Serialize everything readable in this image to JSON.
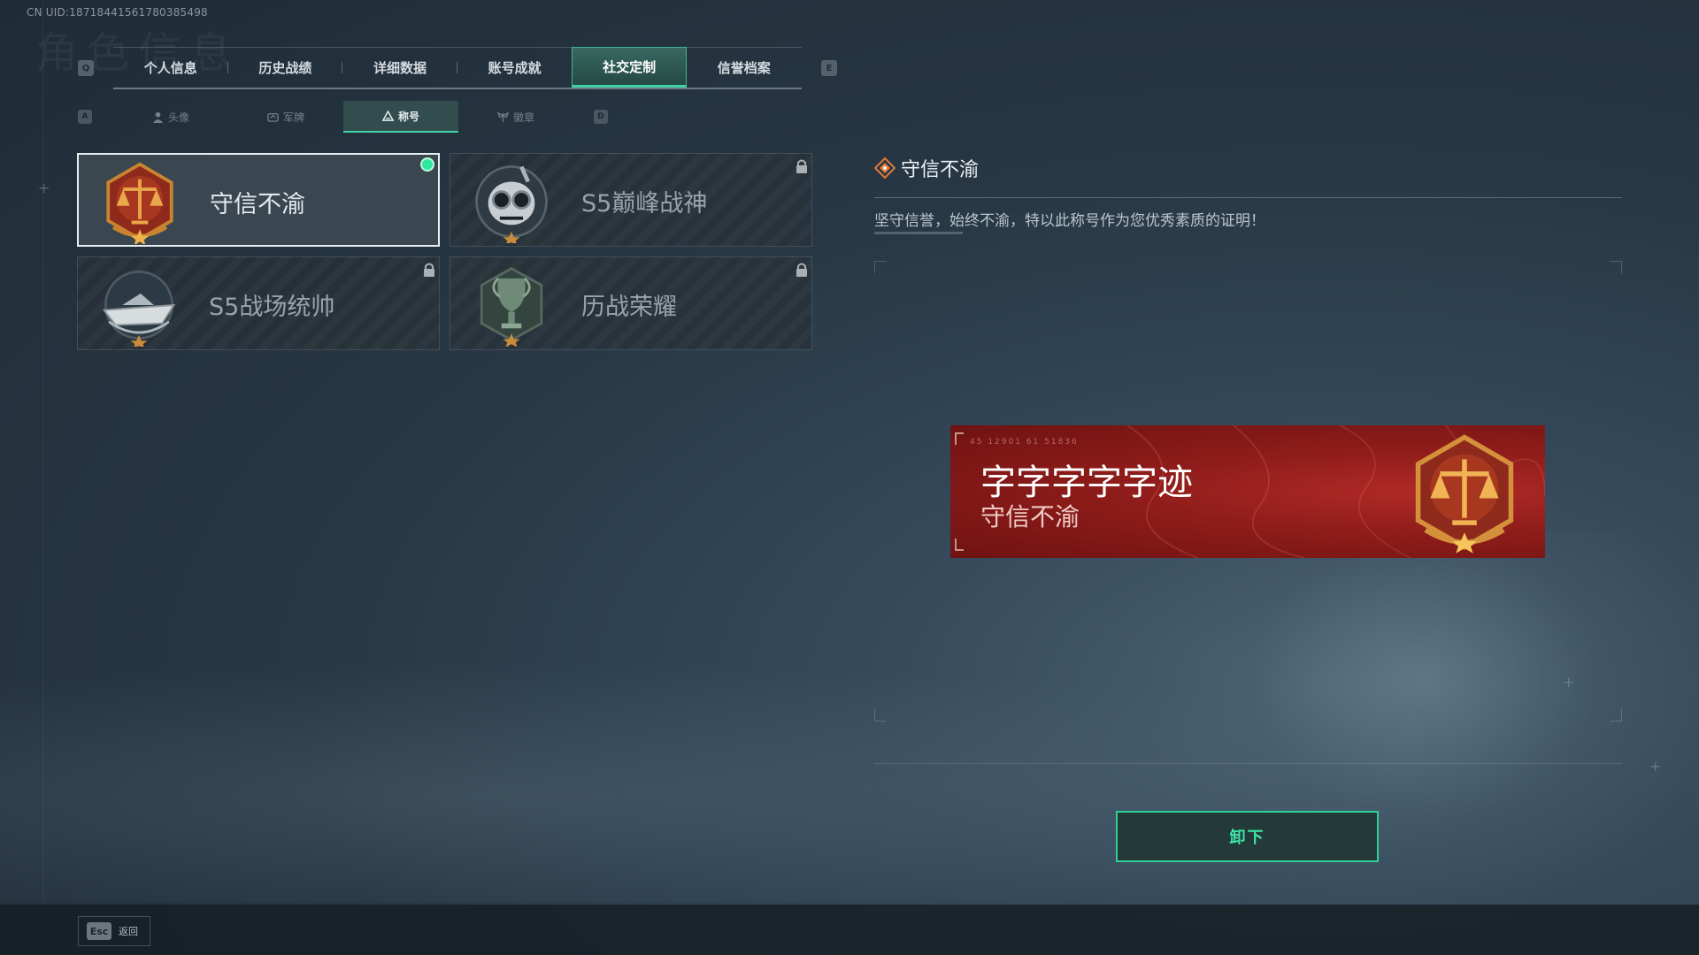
{
  "uid_text": "CN UID:18718441561780385498​",
  "ghost_title": "角色信息",
  "keys": {
    "tab_prev": "Q",
    "tab_next": "E",
    "sub_prev": "A",
    "sub_next": "D"
  },
  "tabs": [
    {
      "label": "个人信息"
    },
    {
      "label": "历史战绩"
    },
    {
      "label": "详细数据"
    },
    {
      "label": "账号成就"
    },
    {
      "label": "社交定制"
    },
    {
      "label": "信誉档案"
    }
  ],
  "active_tab": "社交定制",
  "subtabs": [
    {
      "label": "头像",
      "icon": "person-icon"
    },
    {
      "label": "军牌",
      "icon": "dogtag-icon"
    },
    {
      "label": "称号",
      "icon": "triangle-title-icon"
    },
    {
      "label": "徽章",
      "icon": "wings-badge-icon"
    }
  ],
  "active_subtab": "称号",
  "titles": [
    {
      "name": "守信不渝",
      "state": "selected",
      "badge": "scales-badge-icon"
    },
    {
      "name": "S5巅峰战神",
      "state": "locked",
      "badge": "skull-goggles-badge-icon"
    },
    {
      "name": "S5战场统帅",
      "state": "locked",
      "badge": "speedboat-badge-icon"
    },
    {
      "name": "历战荣耀",
      "state": "locked",
      "badge": "trophy-badge-icon"
    }
  ],
  "detail": {
    "title": "守信不渝",
    "description": "坚守信誉，始终不渝，特以此称号作为您优秀素质的证明！"
  },
  "banner": {
    "player_name": "字字字字字迹",
    "title": "守信不渝",
    "tiny_code": "45  12901   61  51836",
    "color": "#9a211f"
  },
  "unequip_label": "卸下",
  "esc": {
    "key": "Esc",
    "label": "返回"
  },
  "colors": {
    "accent": "#3fd3a6",
    "selected_dot": "#2fe8a0",
    "banner_red": "#9a211f"
  }
}
